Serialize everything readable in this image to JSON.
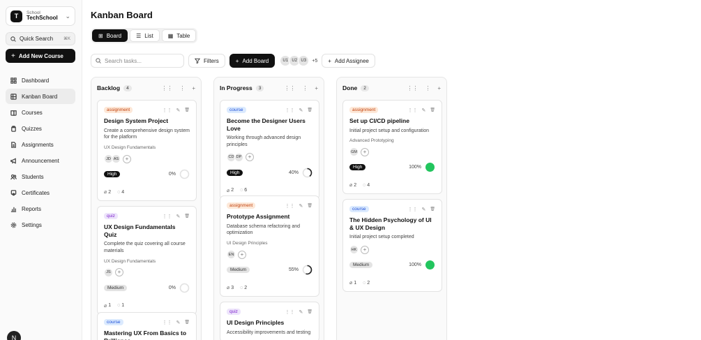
{
  "sidebar": {
    "workspace": {
      "initial": "T",
      "subtitle": "School",
      "name": "TechSchool"
    },
    "quick_search": {
      "label": "Quick Search",
      "shortcut": "⌘K"
    },
    "add_course_label": "Add New Course",
    "nav": [
      {
        "label": "Dashboard",
        "icon": "grid-icon"
      },
      {
        "label": "Kanban Board",
        "icon": "kanban-icon",
        "active": true
      },
      {
        "label": "Courses",
        "icon": "book-icon"
      },
      {
        "label": "Quizzes",
        "icon": "clipboard-icon"
      },
      {
        "label": "Assignments",
        "icon": "file-icon"
      },
      {
        "label": "Announcement",
        "icon": "megaphone-icon"
      },
      {
        "label": "Students",
        "icon": "users-icon"
      },
      {
        "label": "Certificates",
        "icon": "certificate-icon"
      },
      {
        "label": "Reports",
        "icon": "chart-icon"
      },
      {
        "label": "Settings",
        "icon": "gear-icon"
      }
    ],
    "user_initial": "N"
  },
  "header": {
    "title": "Kanban Board"
  },
  "view_tabs": [
    {
      "label": "Board",
      "icon": "board-icon",
      "active": true
    },
    {
      "label": "List",
      "icon": "list-icon"
    },
    {
      "label": "Table",
      "icon": "table-icon"
    }
  ],
  "toolbar": {
    "search_placeholder": "Search tasks...",
    "filters_label": "Filters",
    "add_board_label": "Add Board",
    "assignees": [
      "U1",
      "U2",
      "U3"
    ],
    "more_assignees": "+5",
    "add_assignee_label": "Add Assignee"
  },
  "columns": [
    {
      "title": "Backlog",
      "count": "4",
      "cards": [
        {
          "tag": "assignment",
          "title": "Design System Project",
          "desc": "Create a comprehensive design system for the platform",
          "course": "UX Design Fundamentals",
          "users": [
            "JD",
            "AS"
          ],
          "priority": "High",
          "progress": 0,
          "progress_label": "0%",
          "attachments": "2",
          "comments": "4"
        },
        {
          "tag": "quiz",
          "title": "UX Design Fundamentals Quiz",
          "desc": "Complete the quiz covering all course materials",
          "course": "UX Design Fundamentals",
          "users": [
            "JS"
          ],
          "priority": "Medium",
          "progress": 0,
          "progress_label": "0%",
          "attachments": "1",
          "comments": "1"
        },
        {
          "tag": "course",
          "title": "Mastering UX From Basics to Brilliance",
          "desc": "",
          "course": "",
          "users": [],
          "priority": "",
          "progress": 0,
          "progress_label": "",
          "attachments": "",
          "comments": ""
        }
      ]
    },
    {
      "title": "In Progress",
      "count": "3",
      "cards": [
        {
          "tag": "course",
          "title": "Become the Designer Users Love",
          "desc": "Working through advanced design principles",
          "course": "",
          "users": [
            "CD",
            "DP"
          ],
          "priority": "High",
          "progress": 40,
          "progress_label": "40%",
          "attachments": "2",
          "comments": "6"
        },
        {
          "tag": "assignment",
          "title": "Prototype Assignment",
          "desc": "Database schema refactoring and optimization",
          "course": "UI Design Principles",
          "users": [
            "EN"
          ],
          "priority": "Medium",
          "progress": 55,
          "progress_label": "55%",
          "attachments": "3",
          "comments": "2"
        },
        {
          "tag": "quiz",
          "title": "UI Design Principles",
          "desc": "Accessibility improvements and testing",
          "course": "",
          "users": [],
          "priority": "",
          "progress": 0,
          "progress_label": "",
          "attachments": "",
          "comments": ""
        }
      ]
    },
    {
      "title": "Done",
      "count": "2",
      "cards": [
        {
          "tag": "assignment",
          "title": "Set up CI/CD pipeline",
          "desc": "Initial project setup and configuration",
          "course": "Advanced Prototyping",
          "users": [
            "GM"
          ],
          "priority": "High",
          "progress": 100,
          "progress_label": "100%",
          "attachments": "2",
          "comments": "4"
        },
        {
          "tag": "course",
          "title": "The Hidden Psychology of UI & UX Design",
          "desc": "Initial project setup completed",
          "course": "",
          "users": [
            "HK"
          ],
          "priority": "Medium",
          "progress": 100,
          "progress_label": "100%",
          "attachments": "1",
          "comments": "2"
        }
      ]
    }
  ],
  "colors": {
    "accent": "#111111",
    "done_green": "#22c55e"
  }
}
